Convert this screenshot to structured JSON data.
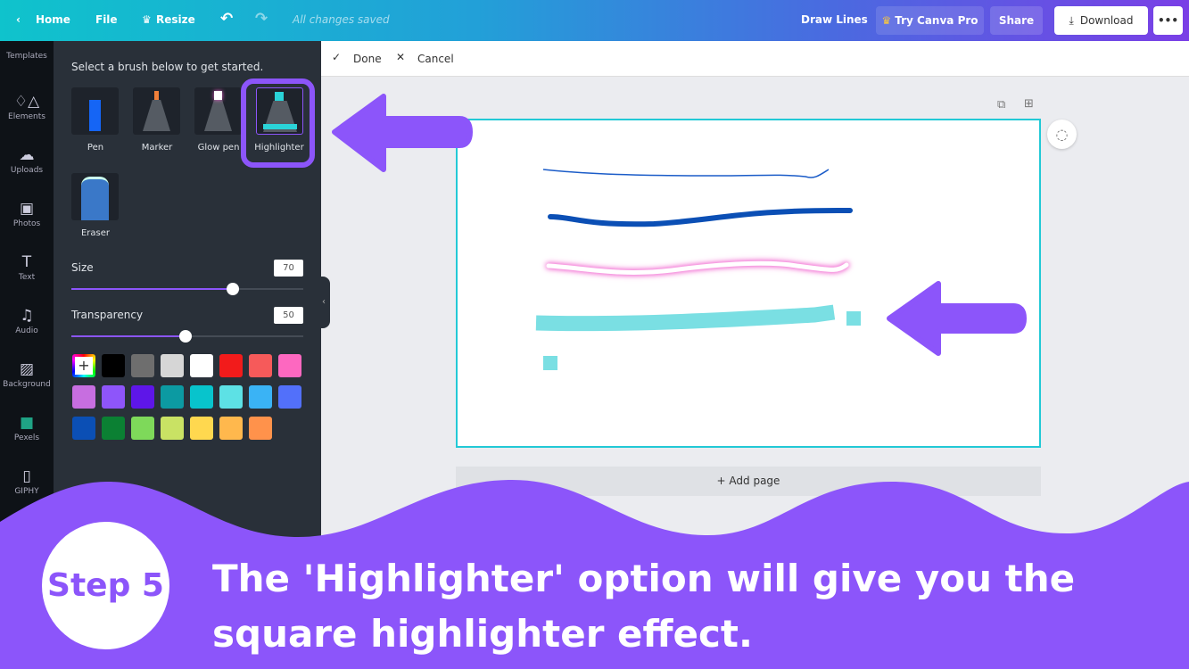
{
  "topbar": {
    "home": "Home",
    "file": "File",
    "resize": "Resize",
    "status": "All changes saved",
    "title": "Draw Lines",
    "try_pro": "Try Canva Pro",
    "share": "Share",
    "download": "Download",
    "more": "•••"
  },
  "rail": [
    {
      "label": "Templates",
      "icon": "template-icon"
    },
    {
      "label": "Elements",
      "icon": "shapes-icon"
    },
    {
      "label": "Uploads",
      "icon": "cloud-upload-icon"
    },
    {
      "label": "Photos",
      "icon": "image-icon"
    },
    {
      "label": "Text",
      "icon": "text-icon"
    },
    {
      "label": "Audio",
      "icon": "music-icon"
    },
    {
      "label": "Background",
      "icon": "hatch-icon"
    },
    {
      "label": "Pexels",
      "icon": "pexels-icon"
    },
    {
      "label": "GIPHY",
      "icon": "giphy-icon"
    }
  ],
  "panel": {
    "instruction": "Select a brush below to get started.",
    "brushes": [
      {
        "label": "Pen",
        "tip": "#1565f5"
      },
      {
        "label": "Marker",
        "tip": "#f0803a"
      },
      {
        "label": "Glow pen",
        "tip": "#f060d0"
      },
      {
        "label": "Highlighter",
        "tip": "#2ad3d8",
        "selected": true
      },
      {
        "label": "Eraser",
        "tip": "#3a78c8"
      }
    ],
    "size_label": "Size",
    "size_value": "70",
    "transparency_label": "Transparency",
    "transparency_value": "50",
    "colors": [
      "#000000",
      "#6e6e6e",
      "#d6d6d6",
      "#ffffff",
      "#f21b1b",
      "#f65a5a",
      "#fd68c0",
      "#c76ee0",
      "#8e55fa",
      "#5e16e8",
      "#0c9aa2",
      "#08c4cc",
      "#5de1e5",
      "#3ab3f5",
      "#5270fa",
      "#0b4fb5",
      "#0b8033",
      "#7ed95a",
      "#c9e264",
      "#ffd84f",
      "#ffb84d",
      "#ff924b"
    ]
  },
  "toolbar": {
    "done": "Done",
    "cancel": "Cancel"
  },
  "canvas": {
    "add_page": "+ Add page"
  },
  "banner": {
    "step": "Step 5",
    "caption": "The 'Highlighter' option will give you the square highlighter effect.",
    "color": "#8c55fa"
  }
}
